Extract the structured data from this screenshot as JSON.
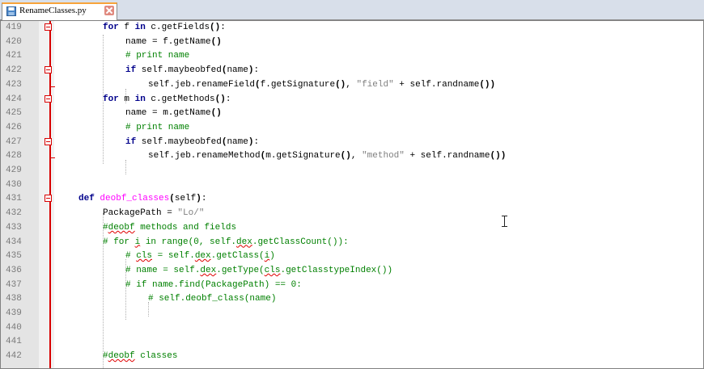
{
  "tab": {
    "label": "RenameClasses.py"
  },
  "lines": [
    {
      "num": "419",
      "text": "for f in c.getFields():"
    },
    {
      "num": "420",
      "text": "name = f.getName()"
    },
    {
      "num": "421",
      "text": "# print name"
    },
    {
      "num": "422",
      "text": "if self.maybeobfed(name):"
    },
    {
      "num": "423",
      "text": "self.jeb.renameField(f.getSignature(), \"field\" + self.randname())"
    },
    {
      "num": "424",
      "text": "for m in c.getMethods():"
    },
    {
      "num": "425",
      "text": "name = m.getName()"
    },
    {
      "num": "426",
      "text": "# print name"
    },
    {
      "num": "427",
      "text": "if self.maybeobfed(name):"
    },
    {
      "num": "428",
      "text": "self.jeb.renameMethod(m.getSignature(), \"method\" + self.randname())"
    },
    {
      "num": "429",
      "text": ""
    },
    {
      "num": "430",
      "text": ""
    },
    {
      "num": "431",
      "text": "def deobf_classes(self):"
    },
    {
      "num": "432",
      "text": "PackagePath = \"Lo/\""
    },
    {
      "num": "433",
      "text": "#deobf methods and fields"
    },
    {
      "num": "434",
      "text": "# for i in range(0, self.dex.getClassCount()):"
    },
    {
      "num": "435",
      "text": "# cls = self.dex.getClass(i)"
    },
    {
      "num": "436",
      "text": "# name = self.dex.getType(cls.getClasstypeIndex())"
    },
    {
      "num": "437",
      "text": "# if name.find(PackagePath) == 0:"
    },
    {
      "num": "438",
      "text": "# self.deobf_class(name)"
    },
    {
      "num": "439",
      "text": ""
    },
    {
      "num": "440",
      "text": ""
    },
    {
      "num": "441",
      "text": ""
    },
    {
      "num": "442",
      "text": "#deobf classes"
    }
  ]
}
